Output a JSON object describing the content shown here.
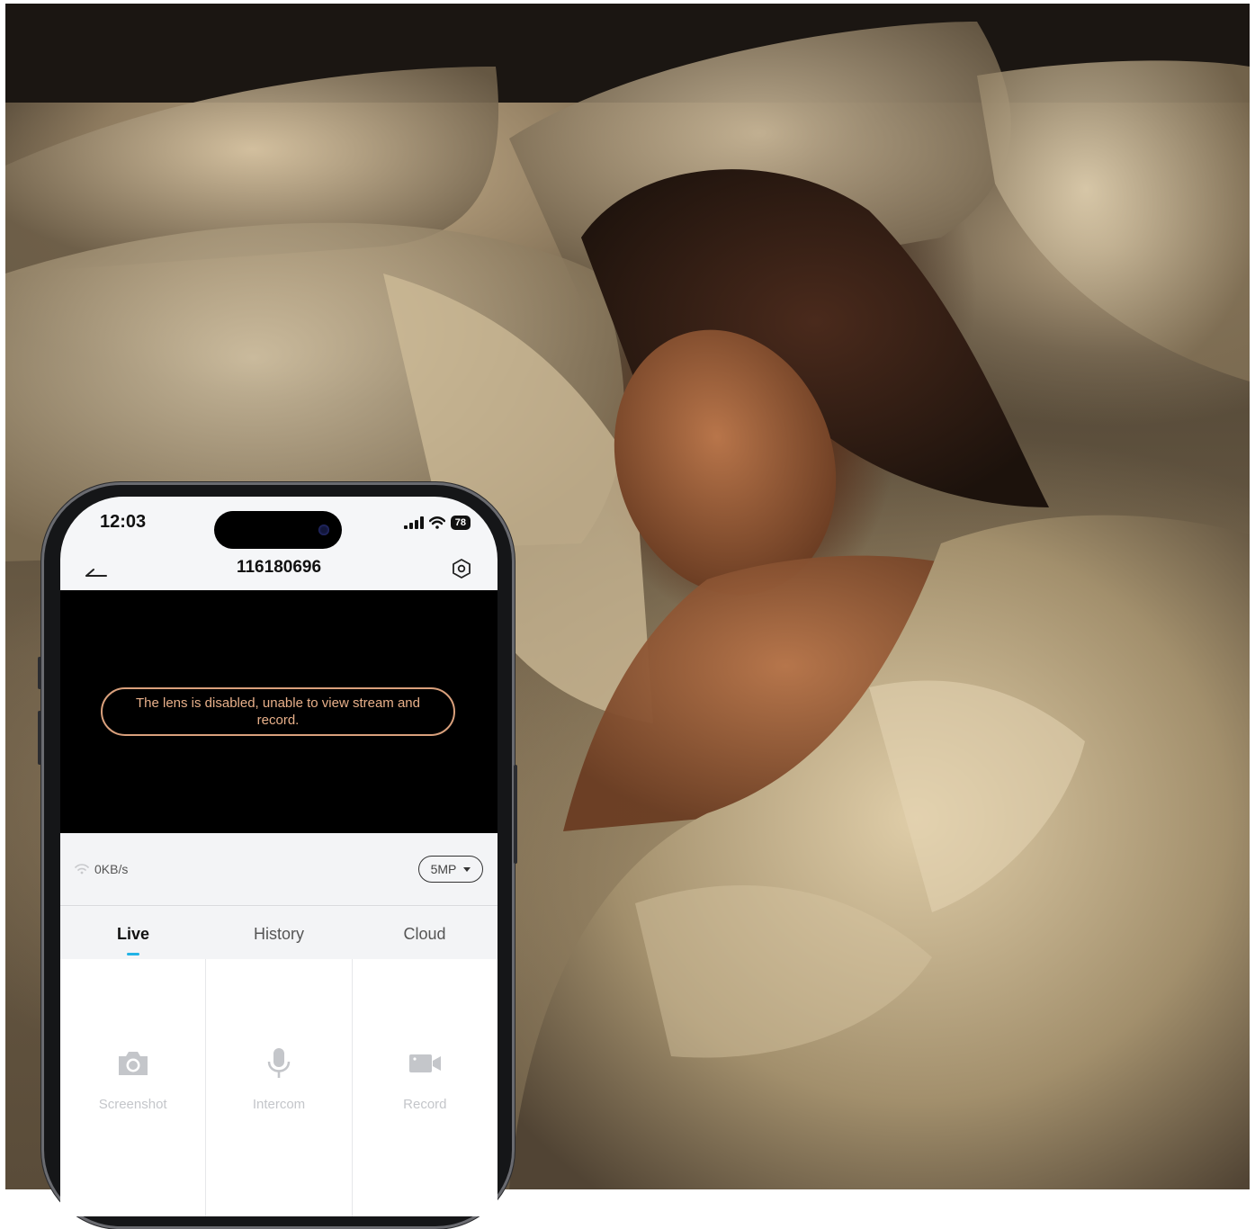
{
  "phone": {
    "status_bar": {
      "time": "12:03",
      "battery": "78",
      "icons": [
        "signal-icon",
        "wifi-icon",
        "battery-icon"
      ]
    },
    "header": {
      "title": "116180696",
      "back_icon": "back-arrow-icon",
      "settings_icon": "settings-hexagon-icon"
    },
    "video": {
      "notice": "The lens is disabled, unable to view stream and record."
    },
    "info_bar": {
      "speed": "0KB/s",
      "resolution": "5MP"
    },
    "tabs": [
      {
        "label": "Live",
        "active": true
      },
      {
        "label": "History",
        "active": false
      },
      {
        "label": "Cloud",
        "active": false
      }
    ],
    "actions": [
      {
        "label": "Screenshot",
        "icon": "camera-icon"
      },
      {
        "label": "Intercom",
        "icon": "microphone-icon"
      },
      {
        "label": "Record",
        "icon": "video-camera-icon"
      }
    ]
  },
  "colors": {
    "accent_tab": "#22b3e6",
    "notice_text": "#e8b08a",
    "disabled_action": "#c4c6ca"
  }
}
